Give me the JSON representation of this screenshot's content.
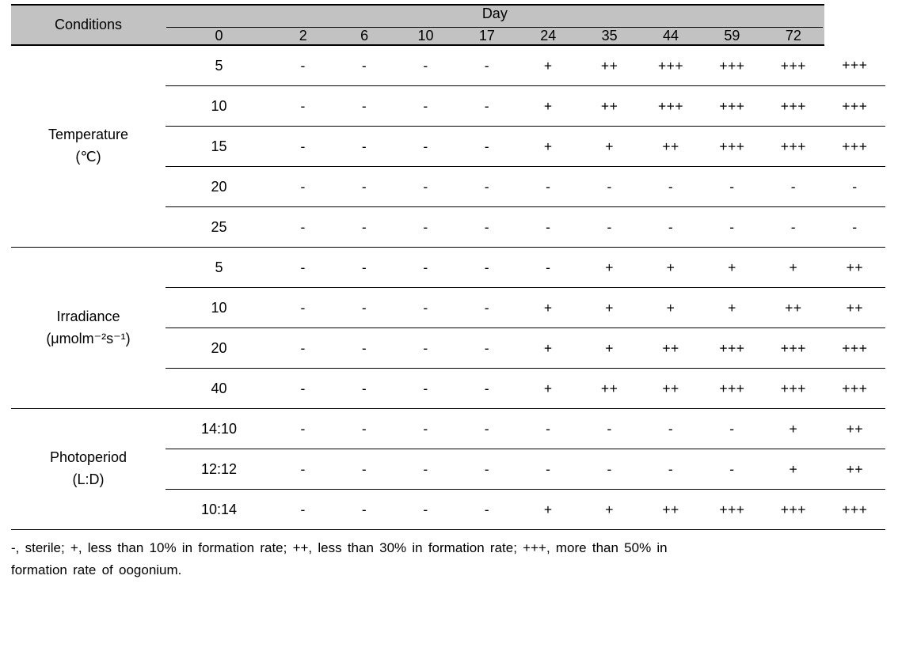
{
  "table": {
    "corner_label": "Conditions",
    "column_group_label": "Day",
    "day_columns": [
      "0",
      "2",
      "6",
      "10",
      "17",
      "24",
      "35",
      "44",
      "59",
      "72"
    ],
    "header_bg": "#c2c2c2",
    "groups": [
      {
        "label_line1": "Temperature",
        "label_line2": "(℃)",
        "rows": [
          {
            "sub": "5",
            "values": [
              "-",
              "-",
              "-",
              "-",
              "+",
              "++",
              "+++",
              "+++",
              "+++",
              "+++"
            ]
          },
          {
            "sub": "10",
            "values": [
              "-",
              "-",
              "-",
              "-",
              "+",
              "++",
              "+++",
              "+++",
              "+++",
              "+++"
            ]
          },
          {
            "sub": "15",
            "values": [
              "-",
              "-",
              "-",
              "-",
              "+",
              "+",
              "++",
              "+++",
              "+++",
              "+++"
            ]
          },
          {
            "sub": "20",
            "values": [
              "-",
              "-",
              "-",
              "-",
              "-",
              "-",
              "-",
              "-",
              "-",
              "-"
            ]
          },
          {
            "sub": "25",
            "values": [
              "-",
              "-",
              "-",
              "-",
              "-",
              "-",
              "-",
              "-",
              "-",
              "-"
            ]
          }
        ]
      },
      {
        "label_line1": "Irradiance",
        "label_line2": "(μmolm⁻²s⁻¹)",
        "rows": [
          {
            "sub": "5",
            "values": [
              "-",
              "-",
              "-",
              "-",
              "-",
              "+",
              "+",
              "+",
              "+",
              "++"
            ]
          },
          {
            "sub": "10",
            "values": [
              "-",
              "-",
              "-",
              "-",
              "+",
              "+",
              "+",
              "+",
              "++",
              "++"
            ]
          },
          {
            "sub": "20",
            "values": [
              "-",
              "-",
              "-",
              "-",
              "+",
              "+",
              "++",
              "+++",
              "+++",
              "+++"
            ]
          },
          {
            "sub": "40",
            "values": [
              "-",
              "-",
              "-",
              "-",
              "+",
              "++",
              "++",
              "+++",
              "+++",
              "+++"
            ]
          }
        ]
      },
      {
        "label_line1": "Photoperiod",
        "label_line2": "(L:D)",
        "rows": [
          {
            "sub": "14:10",
            "values": [
              "-",
              "-",
              "-",
              "-",
              "-",
              "-",
              "-",
              "-",
              "+",
              "++"
            ]
          },
          {
            "sub": "12:12",
            "values": [
              "-",
              "-",
              "-",
              "-",
              "-",
              "-",
              "-",
              "-",
              "+",
              "++"
            ]
          },
          {
            "sub": "10:14",
            "values": [
              "-",
              "-",
              "-",
              "-",
              "+",
              "+",
              "++",
              "+++",
              "+++",
              "+++"
            ]
          }
        ]
      }
    ]
  },
  "footnote": {
    "line1": "-, sterile; +, less than 10% in formation rate; ++, less than 30% in formation rate; +++, more than 50% in",
    "line2": "formation rate of oogonium."
  }
}
